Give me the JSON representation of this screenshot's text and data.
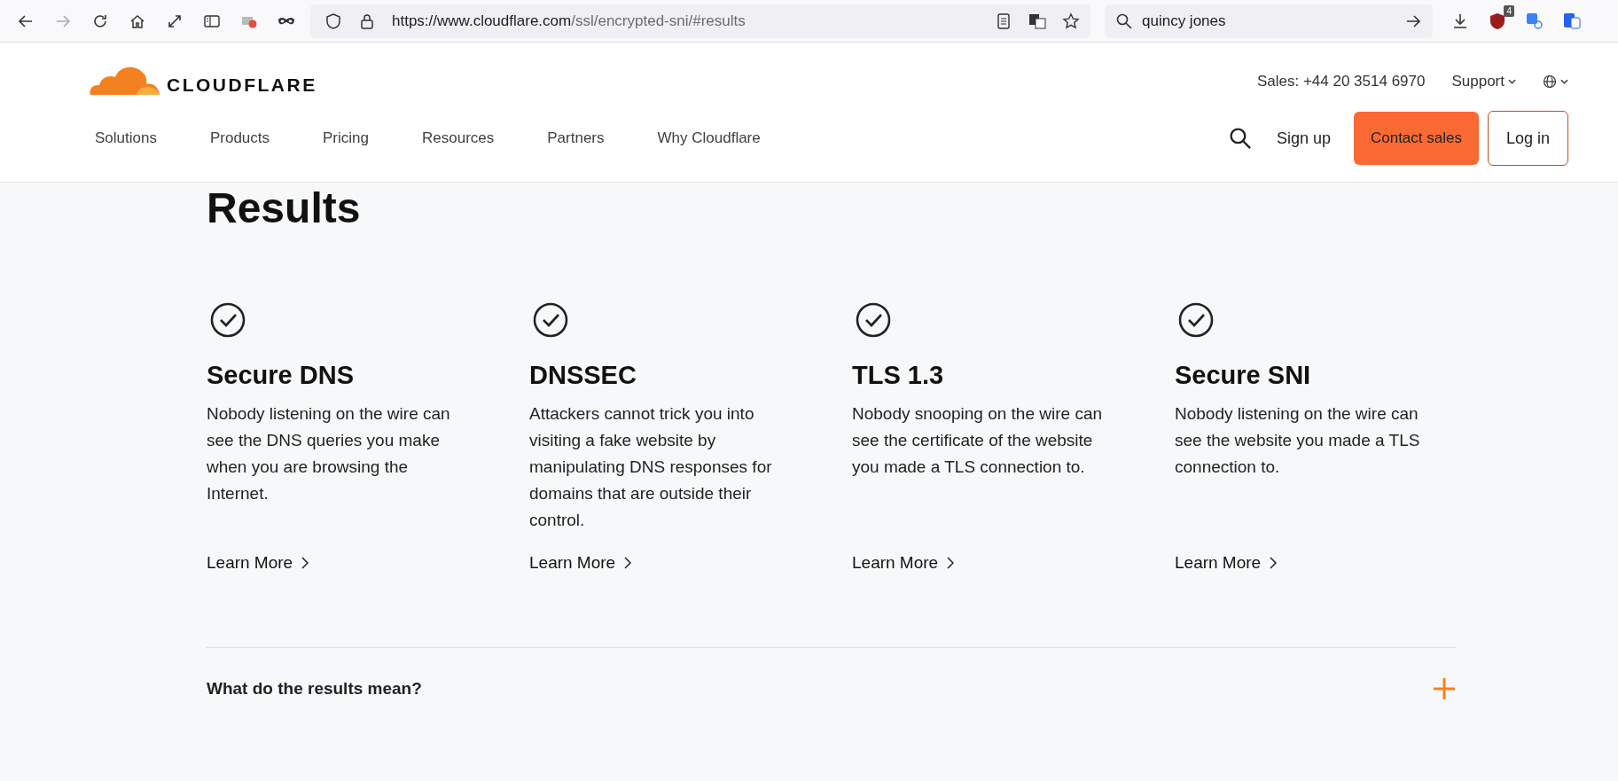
{
  "browser": {
    "url_host": "https://www.cloudflare.com",
    "url_path": "/ssl/encrypted-sni/#results",
    "search_value": "quincy jones",
    "extension_badge": "4"
  },
  "header": {
    "logo_text": "CLOUDFLARE",
    "sales": "Sales: +44 20 3514 6970",
    "support": "Support",
    "nav": [
      "Solutions",
      "Products",
      "Pricing",
      "Resources",
      "Partners",
      "Why Cloudflare"
    ],
    "sign_up": "Sign up",
    "contact_sales": "Contact sales",
    "log_in": "Log in"
  },
  "results": {
    "title": "Results",
    "cards": [
      {
        "title": "Secure DNS",
        "text": "Nobody listening on the wire can see the DNS queries you make when you are browsing the Internet.",
        "link": "Learn More"
      },
      {
        "title": "DNSSEC",
        "text": "Attackers cannot trick you into visiting a fake website by manipulating DNS responses for domains that are outside their control.",
        "link": "Learn More"
      },
      {
        "title": "TLS 1.3",
        "text": "Nobody snooping on the wire can see the certificate of the website you made a TLS connection to.",
        "link": "Learn More"
      },
      {
        "title": "Secure SNI",
        "text": "Nobody listening on the wire can see the website you made a TLS connection to.",
        "link": "Learn More"
      }
    ]
  },
  "faq": [
    {
      "question": "What do the results mean?",
      "expanded": false
    }
  ]
}
